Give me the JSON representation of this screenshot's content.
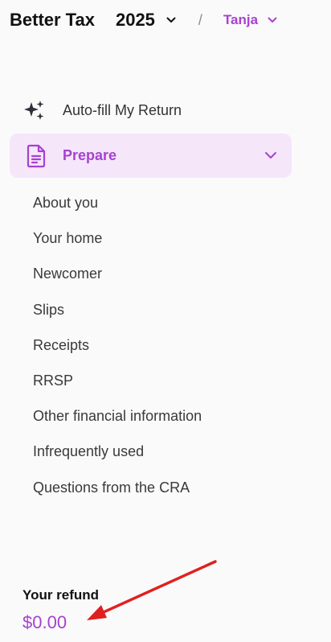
{
  "header": {
    "brand": "Better Tax",
    "year": "2025",
    "separator": "/",
    "user": "Tanja"
  },
  "nav": {
    "autofill": {
      "label": "Auto-fill My Return",
      "icon": "sparkles-icon"
    },
    "prepare": {
      "label": "Prepare",
      "icon": "document-icon",
      "expanded": true
    },
    "subitems": [
      "About you",
      "Your home",
      "Newcomer",
      "Slips",
      "Receipts",
      "RRSP",
      "Other financial information",
      "Infrequently used",
      "Questions from the CRA"
    ]
  },
  "refund": {
    "label": "Your refund",
    "amount": "$0.00"
  },
  "colors": {
    "accent": "#a642cf",
    "accent_bg": "#f5e6fa",
    "annotation_arrow": "#e02020"
  }
}
